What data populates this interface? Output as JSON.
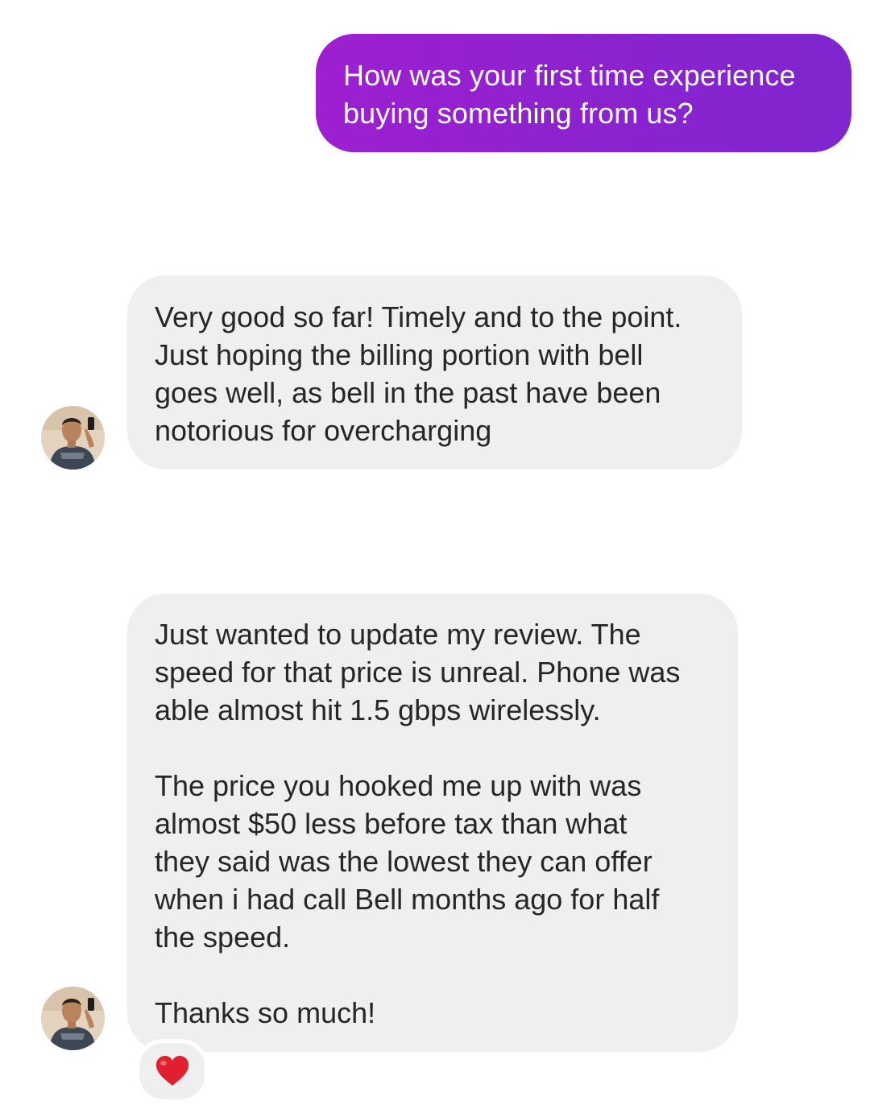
{
  "conversation": {
    "outgoing": [
      {
        "lines": [
          "How was your first time experience",
          "buying something from us?"
        ]
      }
    ],
    "incoming": [
      {
        "lines": [
          "Very good so far! Timely and to the point.",
          "Just hoping the billing portion with bell",
          "goes well, as bell in the past have been",
          "notorious for overcharging"
        ]
      },
      {
        "paragraphs": [
          [
            "Just wanted to update my review. The",
            "speed for that price is unreal. Phone was",
            "able almost hit 1.5 gbps wirelessly."
          ],
          [
            "The price you hooked me up with was",
            "almost $50 less before tax than what",
            "they said was the lowest they can offer",
            "when i had call Bell months ago for half",
            "the speed."
          ],
          [
            "Thanks so much!"
          ]
        ],
        "reaction": "heart-emoji"
      }
    ]
  },
  "colors": {
    "outgoing_bubble": "#8a23cf",
    "incoming_bubble": "#efefef",
    "reaction_heart": "#e0202e"
  }
}
